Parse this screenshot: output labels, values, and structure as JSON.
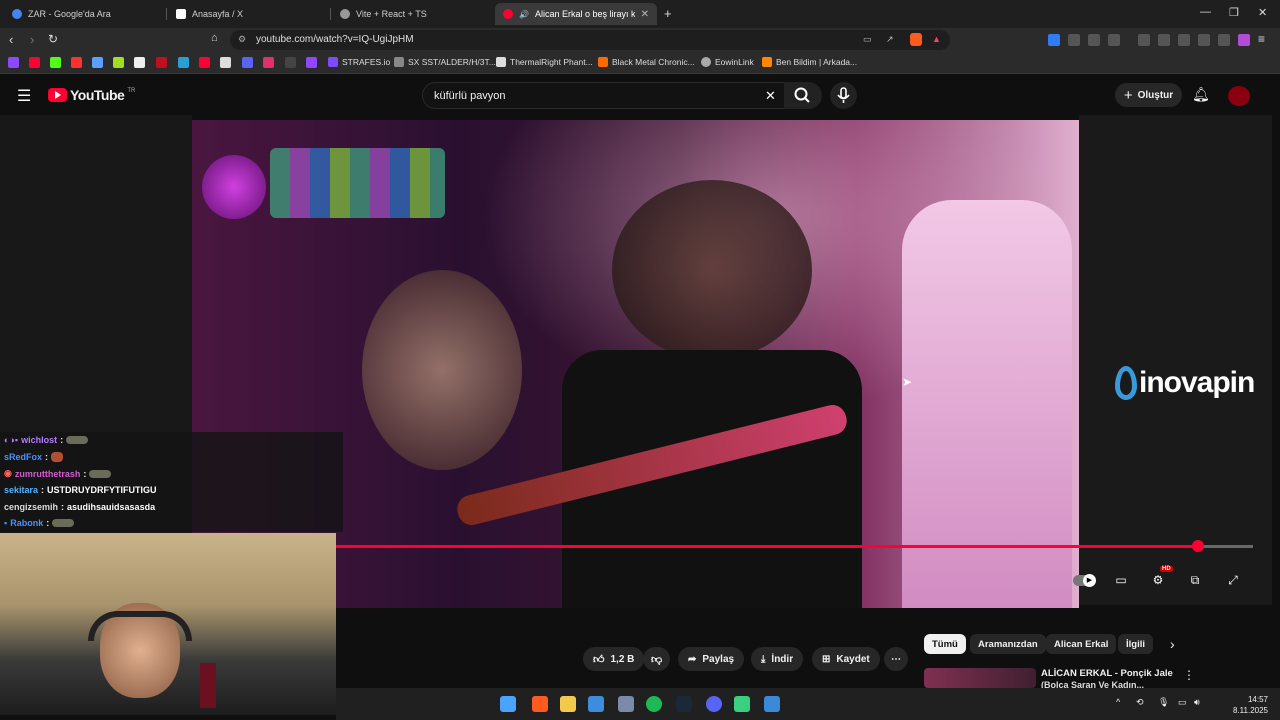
{
  "tabs": [
    {
      "title": "ZAR - Google'da Ara",
      "color": "#4285f4"
    },
    {
      "title": "Anasayfa / X",
      "color": "#ffffff"
    },
    {
      "title": "Vite + React + TS",
      "color": "#aaaaaa"
    },
    {
      "title": "Alican Erkal o beş lirayı kim g",
      "color": "#ff0033"
    }
  ],
  "address": {
    "url": "youtube.com/watch?v=IQ-UgiJpHM"
  },
  "bookmarks": [
    {
      "label": "STRAFES.io",
      "color": "#7b4bff"
    },
    {
      "label": "SX SST/ALDER/H/3T...",
      "color": "#888888"
    },
    {
      "label": "ThermalRight Phant...",
      "color": "#dddddd"
    },
    {
      "label": "Black Metal Chronic...",
      "color": "#ff6a00"
    },
    {
      "label": "EowinLink",
      "color": "#aaaaaa"
    },
    {
      "label": "Ben Bildim | Arkada...",
      "color": "#ff8800"
    }
  ],
  "youtube": {
    "logo_text": "YouTube",
    "logo_region": "TR",
    "search_value": "küfürlü pavyon",
    "create_label": "Oluştur"
  },
  "chat": [
    {
      "user": "wichlost",
      "text": "",
      "color": "#b57bff"
    },
    {
      "user": "sRedFox",
      "text": "",
      "color": "#4f8fff"
    },
    {
      "user": "zumrutthetrash",
      "text": "",
      "color": "#d25bd2"
    },
    {
      "user": "sekitara",
      "text": "USTDRUYDRFYTIFUTIGU",
      "color": "#4fb3ff"
    },
    {
      "user": "cengizsemih",
      "text": "asudihsauidsasasda",
      "color": "#dddddd"
    },
    {
      "user": "Rabonk",
      "text": "",
      "color": "#4f8fff"
    }
  ],
  "overlay_brand": "inovapin",
  "player": {
    "progress_fraction": 0.94,
    "quality_badge": "HD"
  },
  "actions": {
    "like_count": "1,2 B",
    "share_label": "Paylaş",
    "download_label": "İndir",
    "save_label": "Kaydet"
  },
  "chips": [
    {
      "label": "Tümü",
      "selected": true
    },
    {
      "label": "Aramanızdan",
      "selected": false
    },
    {
      "label": "Alican Erkal",
      "selected": false
    },
    {
      "label": "İlgili",
      "selected": false
    }
  ],
  "recommendation": {
    "title": "ALİCAN ERKAL - Ponçik Jale",
    "subtitle": "(Bolca Saran Ve Kadın..."
  },
  "clock": {
    "time": "14:57",
    "date": "8.11.2025"
  },
  "colors": {
    "accent": "#ff0033",
    "background": "#0f0f0f"
  }
}
